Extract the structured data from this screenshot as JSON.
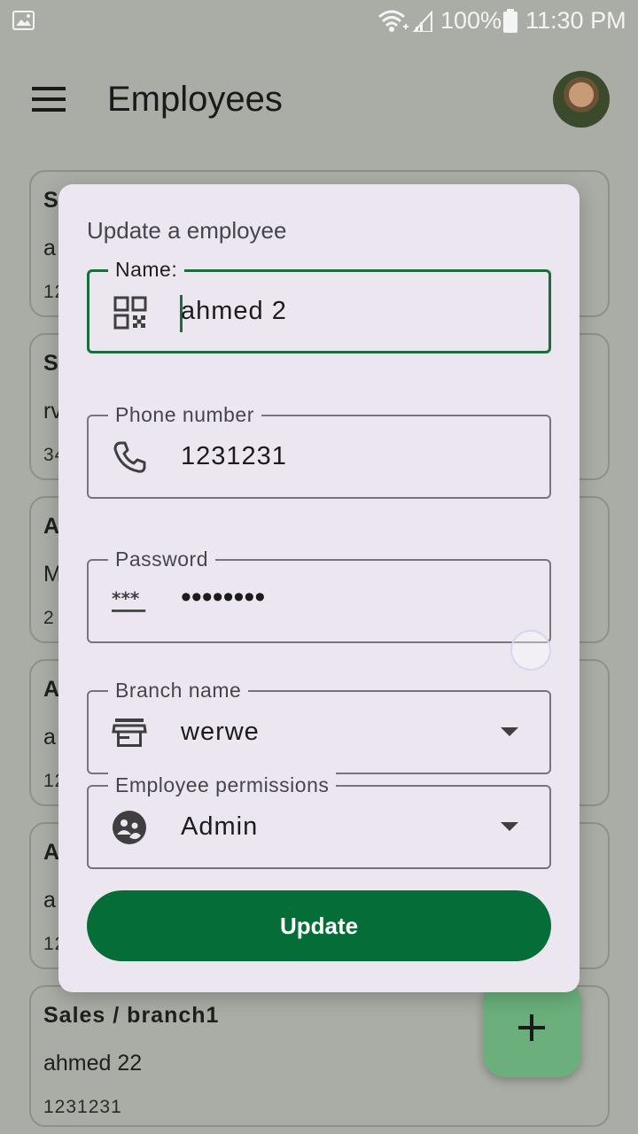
{
  "status_bar": {
    "battery_percent": "100%",
    "time": "11:30 PM",
    "icons": [
      "gallery-icon",
      "wifi-icon",
      "signal-icon",
      "battery-icon"
    ]
  },
  "app_bar": {
    "title": "Employees",
    "menu_icon": "menu-icon",
    "avatar": "profile-avatar"
  },
  "background_cards": [
    {
      "line1": "S",
      "line2": "a",
      "line3": "12"
    },
    {
      "line1": "S",
      "line2": "rv",
      "line3": "34"
    },
    {
      "line1": "A",
      "line2": "M",
      "line3": "2"
    },
    {
      "line1": "A",
      "line2": "a",
      "line3": "12"
    },
    {
      "line1": "A",
      "line2": "a",
      "line3": "12"
    },
    {
      "line1": "Sales / branch1",
      "line2": "ahmed 22",
      "line3": "1231231"
    }
  ],
  "fab": {
    "icon": "plus-icon"
  },
  "dialog": {
    "title": "Update a employee",
    "fields": {
      "name": {
        "label": "Name:",
        "value": "ahmed 2",
        "icon": "qr-code-icon"
      },
      "phone": {
        "label": "Phone number",
        "value": "1231231",
        "icon": "phone-icon"
      },
      "password": {
        "label": "Password",
        "value": "••••••••",
        "icon": "password-icon"
      },
      "branch": {
        "label": "Branch name",
        "value": "werwe",
        "icon": "store-icon"
      },
      "permissions": {
        "label": "Employee permissions",
        "value": "Admin",
        "icon": "group-icon"
      }
    },
    "update_label": "Update"
  },
  "colors": {
    "accent": "#056d38",
    "focus": "#1a6e3c",
    "dialog_bg": "#ece6f0",
    "scrim_bg": "#aaada6",
    "fab_bg": "#6bb07c"
  }
}
